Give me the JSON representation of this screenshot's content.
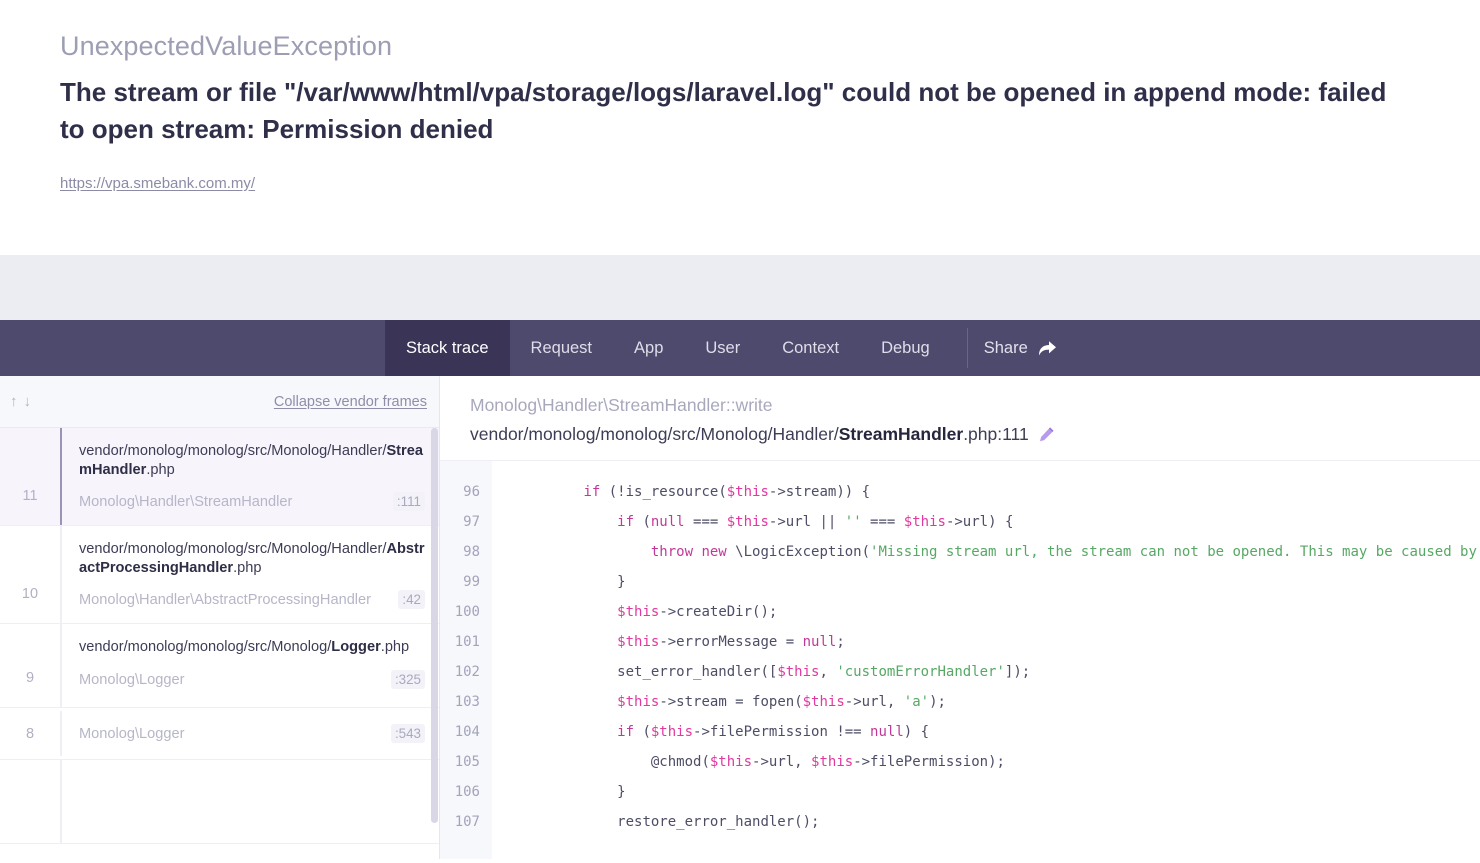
{
  "exception": {
    "class": "UnexpectedValueException",
    "message": "The stream or file \"/var/www/html/vpa/storage/logs/laravel.log\" could not be opened in append mode: failed to open stream: Permission denied",
    "url": "https://vpa.smebank.com.my/"
  },
  "nav": {
    "tabs": [
      {
        "label": "Stack trace",
        "active": true
      },
      {
        "label": "Request",
        "active": false
      },
      {
        "label": "App",
        "active": false
      },
      {
        "label": "User",
        "active": false
      },
      {
        "label": "Context",
        "active": false
      },
      {
        "label": "Debug",
        "active": false
      }
    ],
    "share_label": "Share",
    "share_icon": "share-arrow-icon"
  },
  "sidebar": {
    "sort_up_icon": "arrow-up-icon",
    "sort_down_icon": "arrow-down-icon",
    "collapse_label": "Collapse vendor frames",
    "frames": [
      {
        "number": "11",
        "file_prefix": "vendor/monolog/monolog/src/Monolog/Handler/",
        "file_name": "StreamHandler",
        "file_ext": ".php",
        "class": "Monolog\\Handler\\StreamHandler",
        "line": ":111",
        "active": true,
        "compact": false
      },
      {
        "number": "10",
        "file_prefix": "vendor/monolog/monolog/src/Monolog/Handler/",
        "file_name": "AbstractProcessingHandler",
        "file_ext": ".php",
        "class": "Monolog\\Handler\\AbstractProcessingHandler",
        "line": ":42",
        "active": false,
        "compact": false
      },
      {
        "number": "9",
        "file_prefix": "vendor/monolog/monolog/src/Monolog/",
        "file_name": "Logger",
        "file_ext": ".php",
        "class": "Monolog\\Logger",
        "line": ":325",
        "active": false,
        "compact": false
      },
      {
        "number": "8",
        "file_prefix": "",
        "file_name": "",
        "file_ext": "",
        "class": "Monolog\\Logger",
        "line": ":543",
        "active": false,
        "compact": true
      }
    ]
  },
  "code": {
    "header_class": "Monolog\\Handler\\StreamHandler::write",
    "header_path_prefix": "vendor/monolog/monolog/src/Monolog/Handler/",
    "header_path_file": "StreamHandler",
    "header_path_suffix": ".php:111",
    "edit_icon": "pencil-icon",
    "line_numbers": [
      "96",
      "97",
      "98",
      "99",
      "100",
      "101",
      "102",
      "103",
      "104",
      "105",
      "106",
      "107"
    ],
    "lines": [
      "        if (!is_resource($this->stream)) {",
      "            if (null === $this->url || '' === $this->url) {",
      "                throw new \\LogicException('Missing stream url, the stream can not be opened. This may be caused by a",
      "            }",
      "            $this->createDir();",
      "            $this->errorMessage = null;",
      "            set_error_handler([$this, 'customErrorHandler']);",
      "            $this->stream = fopen($this->url, 'a');",
      "            if ($this->filePermission !== null) {",
      "                @chmod($this->url, $this->filePermission);",
      "            }",
      "            restore_error_handler();"
    ],
    "tokens": [
      [
        [
          "        ",
          "plain"
        ],
        [
          "if",
          "kw"
        ],
        [
          " (!",
          "op"
        ],
        [
          "is_resource",
          "plain"
        ],
        [
          "(",
          "op"
        ],
        [
          "$this",
          "var"
        ],
        [
          "->stream)) {",
          "op"
        ]
      ],
      [
        [
          "            ",
          "plain"
        ],
        [
          "if",
          "kw"
        ],
        [
          " (",
          "op"
        ],
        [
          "null",
          "kw"
        ],
        [
          " === ",
          "op"
        ],
        [
          "$this",
          "var"
        ],
        [
          "->url || ",
          "op"
        ],
        [
          "''",
          "str"
        ],
        [
          " === ",
          "op"
        ],
        [
          "$this",
          "var"
        ],
        [
          "->url) {",
          "op"
        ]
      ],
      [
        [
          "                ",
          "plain"
        ],
        [
          "throw",
          "kw"
        ],
        [
          " ",
          "plain"
        ],
        [
          "new",
          "kw"
        ],
        [
          " \\LogicException(",
          "op"
        ],
        [
          "'Missing stream url, the stream can not be opened. This may be caused by a",
          "str"
        ]
      ],
      [
        [
          "            }",
          "op"
        ]
      ],
      [
        [
          "            ",
          "plain"
        ],
        [
          "$this",
          "var"
        ],
        [
          "->createDir();",
          "op"
        ]
      ],
      [
        [
          "            ",
          "plain"
        ],
        [
          "$this",
          "var"
        ],
        [
          "->errorMessage = ",
          "op"
        ],
        [
          "null",
          "kw"
        ],
        [
          ";",
          "op"
        ]
      ],
      [
        [
          "            ",
          "plain"
        ],
        [
          "set_error_handler",
          "plain"
        ],
        [
          "([",
          "op"
        ],
        [
          "$this",
          "var"
        ],
        [
          ", ",
          "op"
        ],
        [
          "'customErrorHandler'",
          "str"
        ],
        [
          "]);",
          "op"
        ]
      ],
      [
        [
          "            ",
          "plain"
        ],
        [
          "$this",
          "var"
        ],
        [
          "->stream = ",
          "op"
        ],
        [
          "fopen",
          "plain"
        ],
        [
          "(",
          "op"
        ],
        [
          "$this",
          "var"
        ],
        [
          "->url, ",
          "op"
        ],
        [
          "'a'",
          "str"
        ],
        [
          ");",
          "op"
        ]
      ],
      [
        [
          "            ",
          "plain"
        ],
        [
          "if",
          "kw"
        ],
        [
          " (",
          "op"
        ],
        [
          "$this",
          "var"
        ],
        [
          "->filePermission !== ",
          "op"
        ],
        [
          "null",
          "kw"
        ],
        [
          ") {",
          "op"
        ]
      ],
      [
        [
          "                ",
          "plain"
        ],
        [
          "@chmod",
          "plain"
        ],
        [
          "(",
          "op"
        ],
        [
          "$this",
          "var"
        ],
        [
          "->url, ",
          "op"
        ],
        [
          "$this",
          "var"
        ],
        [
          "->filePermission);",
          "op"
        ]
      ],
      [
        [
          "            }",
          "op"
        ]
      ],
      [
        [
          "            ",
          "plain"
        ],
        [
          "restore_error_handler",
          "plain"
        ],
        [
          "();",
          "op"
        ]
      ]
    ]
  },
  "colors": {
    "nav_bg": "#4e4a6d",
    "nav_active_bg": "#3a3457",
    "band_bg": "#ebedf3",
    "accent": "#7a4bbd",
    "frame_active_bg": "#f8f4fc"
  }
}
